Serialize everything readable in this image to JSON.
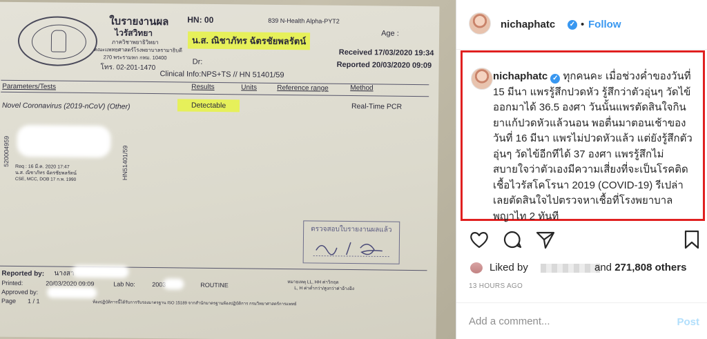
{
  "report": {
    "title": "ใบรายงานผล",
    "subtitle": "ไวรัสวิทยา",
    "department": "ภาควิชาพยาธิวิทยา",
    "institution": "คณะแพทยศาสตร์โรงพยาบาลรามาธิบดี",
    "address": "270 พระรามหก กทม. 10400",
    "phone": "โทร. 02-201-1470",
    "hn_label": "HN: 00",
    "patient_name": "น.ส. ณิชาภัทร ฉัตรชัยพลรัตน์",
    "lab_code": "839 N-Health Alpha-PYT2",
    "age_label": "Age :",
    "dr_label": "Dr:",
    "received": "Received  17/03/2020 19:34",
    "reported": "Reported  20/03/2020 09:09",
    "clinical_info": "Clinical Info:NPS+TS // HN 51401/59",
    "headers": [
      "Parameters/Tests",
      "Results",
      "Units",
      "Reference range",
      "Method"
    ],
    "test_name": "Novel Coronavirus (2019-nCoV) (Other)",
    "result": "Detectable",
    "method": "Real-Time PCR",
    "reported_by": "Reported by:",
    "reported_by_name": "นางสา",
    "printed": "Printed:",
    "printed_date": "20/03/2020 09:09",
    "lab_no": "Lab No:",
    "lab_no_value": "2003",
    "routine": "ROUTINE",
    "approved_by": "Approved by:",
    "page_label": "Page",
    "page_value": "1 / 1",
    "verify_stamp": "ตรวจสอบใบรายงานผลแล้ว",
    "side_code": "HN51401/59",
    "side_code2": "520004959",
    "label_line1": "Req : 16 มี.ค. 2020   17:47",
    "label_line2": "น.ส. ณิชาภัทร ฉัตรชัยพลรัตน์",
    "label_line3": "CSE, MCC,          DOB 17 ก.พ. 1990",
    "footnote": "ห้องปฏิบัติการนี้ได้รับการรับรองมาตรฐาน ISO 15189 จากสำนักมาตรฐานห้องปฏิบัติการ กรมวิทยาศาสตร์การแพทย์",
    "note_right1": "หมายเหตุ LL, HH ค่าวิกฤต",
    "note_right2": "L, H ค่าต่ำกว่า/สูงกว่าค่าอ้างอิง"
  },
  "instagram": {
    "header_username": "nichaphatc",
    "follow_label": "Follow",
    "separator": "•",
    "caption_username": "nichaphatc",
    "caption": "ทุกคนคะ เมื่อช่วงค่ำของวันที่ 15 มีนา แพรรู้สึกปวดหัว รู้สึกว่าตัวอุ่นๆ วัดไข้ออกมาได้ 36.5 องศา วันนั้นแพรตัดสินใจกินยาแก้ปวดหัวแล้วนอน พอตื่นมาตอนเช้าของวันที่ 16 มีนา แพรไม่ปวดหัวแล้ว แต่ยังรู้สึกตัวอุ่นๆ วัดไข้อีกทีได้ 37 องศา แพรรู้สึกไม่สบายใจว่าตัวเองมีความเสี่ยงที่จะเป็นโรคติดเชื้อไวรัสโคโรนา 2019 (COVID-19) รีเปล่า เลยตัดสินใจไปตรวจหาเชื้อที่โรงพยาบาลพญาไท 2 ทันที",
    "liked_by": "Liked by",
    "and_label": "and",
    "likes_count": "271,808 others",
    "timestamp": "13 HOURS AGO",
    "comment_placeholder": "Add a comment...",
    "post_label": "Post",
    "icons": [
      "heart-icon",
      "comment-icon",
      "share-icon",
      "bookmark-icon"
    ],
    "colors": {
      "link": "#3897f0",
      "highlight_border": "#e02020",
      "text": "#262626",
      "muted": "#8e8e8e",
      "post_disabled": "#b2dffc"
    }
  }
}
